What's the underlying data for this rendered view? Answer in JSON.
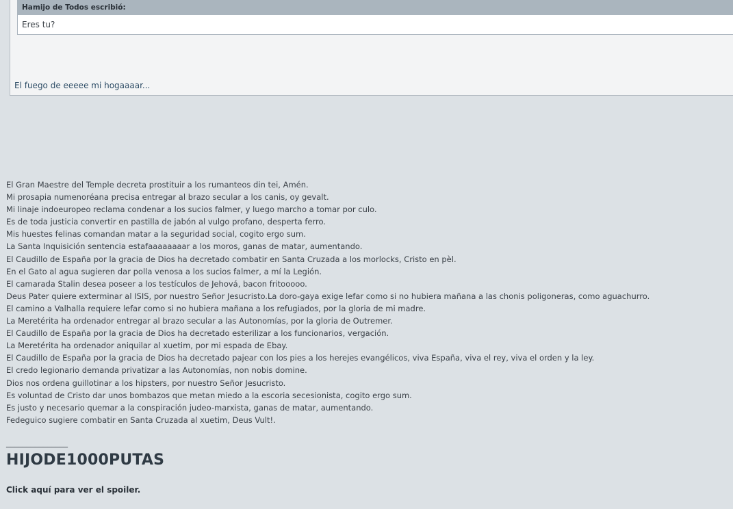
{
  "quote": {
    "author": "Hamijo de Todos escribió:",
    "text": "Eres tu?"
  },
  "post": {
    "text": "El fuego de eeeee mi hogaaaar..."
  },
  "signature": {
    "lines": [
      "El Gran Maestre del Temple decreta prostituir a los rumanteos din tei, Amén.",
      "Mi prosapia numenoréana precisa entregar al brazo secular a los canis, oy gevalt.",
      "Mi linaje indoeuropeo reclama condenar a los sucios falmer, y luego marcho a tomar por culo.",
      "Es de toda justicia convertir en pastilla de jabón al vulgo profano, desperta ferro.",
      "Mis huestes felinas comandan matar a la seguridad social, cogito ergo sum.",
      "La Santa Inquisición sentencia estafaaaaaaaar a los moros, ganas de matar, aumentando.",
      "El Caudillo de España por la gracia de Dios ha decretado combatir en Santa Cruzada a los morlocks, Cristo en pèl.",
      "En el Gato al agua sugieren dar polla venosa a los sucios falmer, a mí la Legión.",
      "El camarada Stalin desea poseer a los testículos de Jehová, bacon fritooooo.",
      "Deus Pater quiere exterminar al ISIS, por nuestro Señor Jesucristo.La doro-gaya exige lefar como si no hubiera mañana a las chonis poligoneras, como aguachurro.",
      "El camino a Valhalla requiere lefar como si no hubiera mañana a los refugiados, por la gloria de mi madre.",
      "La Meretérita ha ordenador entregar al brazo secular a las Autonomías, por la gloria de Outremer.",
      "El Caudillo de España por la gracia de Dios ha decretado esterilizar a los funcionarios, vergación.",
      "La Meretérita ha ordenador aniquilar al xuetim, por mi espada de Ebay.",
      "El Caudillo de España por la gracia de Dios ha decretado pajear con los pies a los herejes evangélicos, viva España, viva el rey, viva el orden y la ley.",
      "El credo legionario demanda privatizar a las Autonomías, non nobis domine.",
      "Dios nos ordena guillotinar a los hipsters, por nuestro Señor Jesucristo.",
      "Es voluntad de Cristo dar unos bombazos que metan miedo a la escoria secesionista, cogito ergo sum.",
      "Es justo y necesario quemar a la conspiración judeo-marxista, ganas de matar, aumentando.",
      "Fedeguico sugiere combatir en Santa Cruzada al xuetim, Deus Vult!."
    ],
    "divider": "_______________",
    "big_title": "HIJODE1000PUTAS",
    "spoiler_label": "Click aquí para ver el spoiler."
  }
}
